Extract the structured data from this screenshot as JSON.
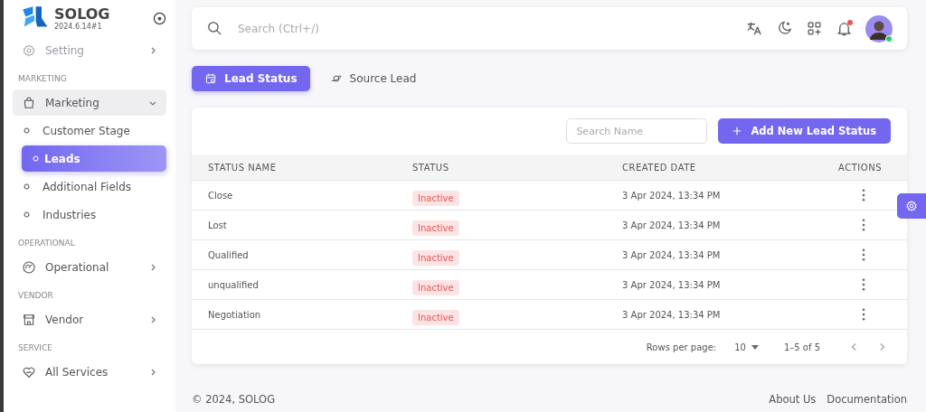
{
  "brand": {
    "name": "SOLOG",
    "version": "2024.6.14#1"
  },
  "sidebar": {
    "top_items": [
      {
        "label": "Setting",
        "kind": "gear",
        "dimmed": true,
        "expanded": false
      }
    ],
    "sections": [
      {
        "title": "MARKETING",
        "items": [
          {
            "label": "Marketing",
            "kind": "bag",
            "expanded": true,
            "children": [
              {
                "label": "Customer Stage",
                "selected": false
              },
              {
                "label": "Leads",
                "selected": true
              },
              {
                "label": "Additional Fields",
                "selected": false
              },
              {
                "label": "Industries",
                "selected": false
              }
            ]
          }
        ]
      },
      {
        "title": "OPERATIONAL",
        "items": [
          {
            "label": "Operational",
            "kind": "gauge",
            "expanded": false
          }
        ]
      },
      {
        "title": "VENDOR",
        "items": [
          {
            "label": "Vendor",
            "kind": "store",
            "expanded": false
          }
        ]
      },
      {
        "title": "SERVICE",
        "items": [
          {
            "label": "All Services",
            "kind": "heart",
            "expanded": false
          }
        ]
      }
    ]
  },
  "header": {
    "search": {
      "placeholder": "Search (Ctrl+/)"
    },
    "notifications_unread": true,
    "user_online": true
  },
  "tabs": [
    {
      "label": "Lead Status",
      "kind": "calendar",
      "selected": true
    },
    {
      "label": "Source Lead",
      "kind": "planet",
      "selected": false
    }
  ],
  "toolbar": {
    "search": {
      "placeholder": "Search Name"
    },
    "add_button": "Add New Lead Status"
  },
  "table": {
    "columns": [
      "STATUS NAME",
      "STATUS",
      "CREATED DATE",
      "ACTIONS"
    ],
    "rows": [
      {
        "name": "Close",
        "status": "Inactive",
        "active": false,
        "created": "3 Apr 2024, 13:34 PM"
      },
      {
        "name": "Lost",
        "status": "Inactive",
        "active": false,
        "created": "3 Apr 2024, 13:34 PM"
      },
      {
        "name": "Qualified",
        "status": "Inactive",
        "active": false,
        "created": "3 Apr 2024, 13:34 PM"
      },
      {
        "name": "unqualified",
        "status": "Inactive",
        "active": false,
        "created": "3 Apr 2024, 13:34 PM"
      },
      {
        "name": "Negotiation",
        "status": "Inactive",
        "active": false,
        "created": "3 Apr 2024, 13:34 PM"
      }
    ]
  },
  "pagination": {
    "rows_label": "Rows per page:",
    "rows_value": "10",
    "range": "1–5 of 5"
  },
  "footer": {
    "copyright": "© 2024, SOLOG",
    "links": [
      "About Us",
      "Documentation"
    ]
  }
}
